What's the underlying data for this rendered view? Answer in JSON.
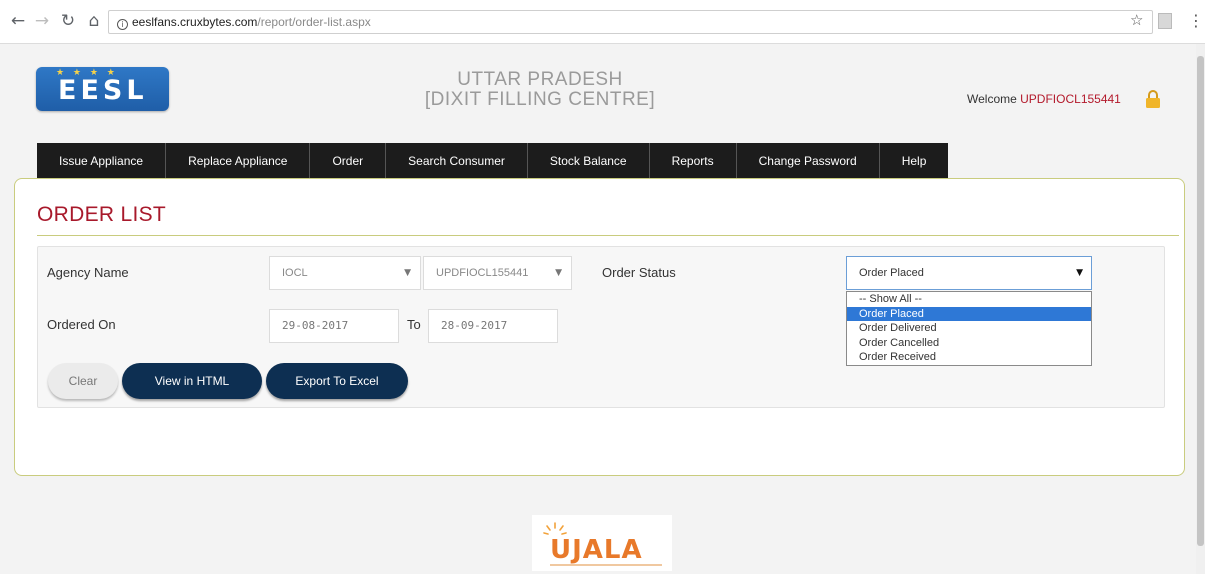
{
  "browser": {
    "url_host": "eeslfans.cruxbytes.com",
    "url_path": "/report/order-list.aspx",
    "back_icon": "arrow-left-icon",
    "forward_icon": "arrow-right-icon",
    "reload_icon": "reload-icon",
    "home_icon": "home-icon",
    "info_glyph": "i",
    "star_glyph": "☆",
    "menu_glyph": "⋮"
  },
  "header": {
    "logo_text": "EESL",
    "title_line1": "UTTAR PRADESH",
    "title_line2": "[DIXIT FILLING CENTRE]",
    "welcome_label": "Welcome",
    "username": "UPDFIOCL155441"
  },
  "nav": {
    "items": [
      {
        "label": "Issue Appliance"
      },
      {
        "label": "Replace Appliance"
      },
      {
        "label": "Order"
      },
      {
        "label": "Search Consumer"
      },
      {
        "label": "Stock Balance"
      },
      {
        "label": "Reports"
      },
      {
        "label": "Change Password"
      },
      {
        "label": "Help"
      }
    ]
  },
  "main": {
    "heading": "ORDER LIST",
    "agency_label": "Agency Name",
    "agency_company": "IOCL",
    "agency_code": "UPDFIOCL155441",
    "order_status_label": "Order Status",
    "order_status_value": "Order Placed",
    "ordered_on_label": "Ordered On",
    "from_date": "29-08-2017",
    "to_label": "To",
    "to_date": "28-09-2017",
    "status_options": [
      "-- Show All --",
      "Order Placed",
      "Order Delivered",
      "Order Cancelled",
      "Order Received"
    ],
    "buttons": {
      "clear": "Clear",
      "view_html": "View in HTML",
      "export_excel": "Export To Excel"
    }
  },
  "footer": {
    "logo_text": "UJALA"
  },
  "colors": {
    "accent_red": "#a8192b",
    "nav_bg": "#1c1c1c",
    "button_dark": "#0d2f52",
    "selected_option": "#2e78d6",
    "panel_border": "#c9cc7e"
  }
}
